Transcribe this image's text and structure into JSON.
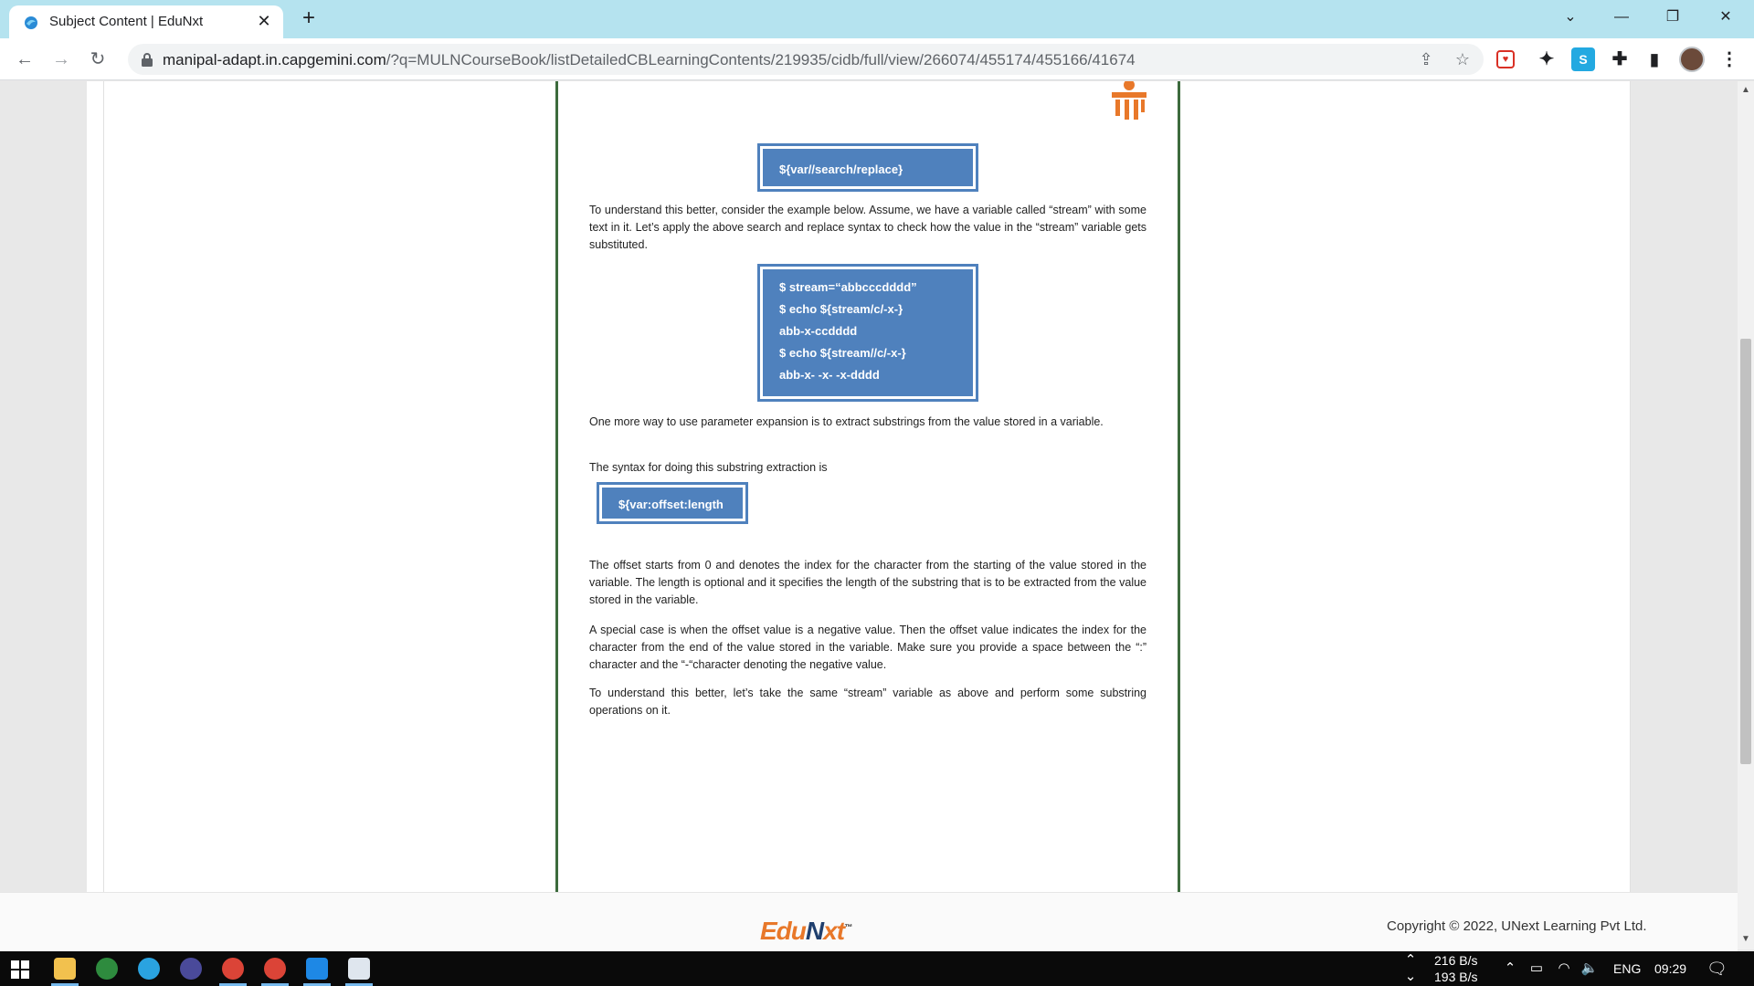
{
  "browser": {
    "tab_title": "Subject Content | EduNxt",
    "url_host": "manipal-adapt.in.capgemini.com",
    "url_path": "/?q=MULNCourseBook/listDetailedCBLearningContents/219935/cidb/full/view/266074/455174/455166/41674"
  },
  "doc": {
    "box1_code": "${var//search/replace}",
    "para1": "To understand this better, consider the example below. Assume, we have a variable called “stream” with some text in it. Let’s apply the above search and replace syntax to check how the value in the “stream” variable gets substituted.",
    "box2_lines": [
      "$ stream=“abbcccdddd”",
      "$ echo ${stream/c/-x-}",
      "abb-x-ccdddd",
      "$ echo ${stream//c/-x-}",
      "abb-x- -x- -x-dddd"
    ],
    "para2": "One more way to use parameter expansion is to extract substrings from the value stored in a variable.",
    "para3": "The syntax for doing this substring extraction is",
    "box3_code": "${var:offset:length",
    "para4": "The offset starts from 0 and denotes the index for the character from the starting of the value stored in the variable. The length is optional and it specifies the length of the substring that is to be extracted from the value stored in the variable.",
    "para5": "A special case is when the offset value is a negative value. Then the offset value indicates the index for the character from the end of the value stored in the variable. Make sure you provide a space between the “:” character and the “-“character denoting the negative value.",
    "para6": "To understand this better, let’s take the same “stream” variable as above and perform some substring operations on it."
  },
  "footer": {
    "logo_edu": "Edu",
    "logo_n": "N",
    "logo_xt": "xt",
    "logo_tm": "™",
    "copyright": "Copyright © 2022, UNext Learning Pvt Ltd."
  },
  "taskbar": {
    "net_up": "216 B/s",
    "net_down": "193 B/s",
    "lang": "ENG",
    "time": "09:29"
  },
  "colors": {
    "tabstrip": "#b5e3ef",
    "code_box": "#4f81bd",
    "page_border": "#3d6b3d",
    "edunxt_orange": "#e8782a"
  }
}
